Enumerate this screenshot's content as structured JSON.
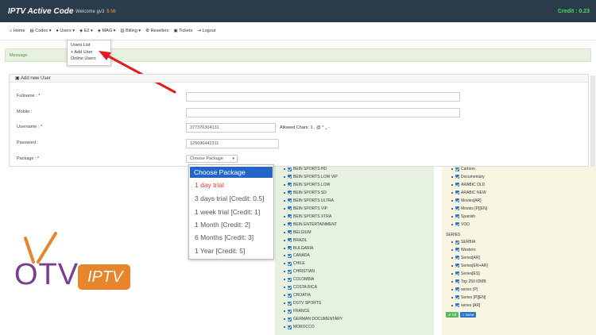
{
  "header": {
    "title": "IPTV Active Code",
    "welcome": "Welcome gv3",
    "user_number": "$ Mr",
    "credit": "Credit : 0.23"
  },
  "nav": [
    {
      "icon": "home-icon",
      "label": "Home"
    },
    {
      "icon": "codes-icon",
      "label": "Codes"
    },
    {
      "icon": "users-icon",
      "label": "Users"
    },
    {
      "icon": "e2-icon",
      "label": "E2"
    },
    {
      "icon": "mag-icon",
      "label": "MAG"
    },
    {
      "icon": "billing-icon",
      "label": "Billing"
    },
    {
      "icon": "resellers-icon",
      "label": "Resellers"
    },
    {
      "icon": "tickets-icon",
      "label": "Tickets"
    },
    {
      "icon": "logout-icon",
      "label": "Logout"
    }
  ],
  "users_menu": [
    "Users List",
    "+ Add User",
    "Online Users"
  ],
  "message": "Message",
  "panel": {
    "title": "Add new User",
    "labels": {
      "fullname": "Fullname : *",
      "mobile": "Mobile :",
      "username": "Username : *",
      "password": "Password :",
      "package": "Package : *"
    },
    "username_value": "377376304131",
    "password_value": "129696442311",
    "allowed_chars": "Allowed Chars: 1 , @ * _ -",
    "package_value": "Choose Package"
  },
  "packages": [
    "Choose Package",
    "1 day trial",
    "3 days trial [Credit: 0.5]",
    "1 week trial [Credit: 1]",
    "1 Month [Credit: 2]",
    "6 Months [Credit: 3]",
    "1 Year [Credit: 5]"
  ],
  "channels_left": [
    "BEIN SPORTS HD",
    "BEIN SPORTS LOW VIP",
    "BEIN SPORTS LOW",
    "BEIN SPORTS SD",
    "BEIN SPORTS ULTRA",
    "BEIN SPORTS VIP",
    "BEIN SPORTS XTRA",
    "BEIN ENTERTAINMENT",
    "BELGIUM",
    "BRAZIL",
    "BULGARIA",
    "CANADA",
    "CHILE",
    "CHRISTIAN",
    "COLOMBIA",
    "COSTA RICA",
    "CROATIA",
    "DSTV SPORTS",
    "FRANCE",
    "GERMAN DOCUMENTARY",
    "MOROCCO"
  ],
  "channels_right": [
    "Cartoon",
    "Documentary",
    "ARABIC OLD",
    "ARABIC NEW",
    "Movies[AR]",
    "Movies [P][EN]",
    "Spanish",
    "VOD"
  ],
  "series_header": "SERIES",
  "series": [
    "SERBIA",
    "Western",
    "Series[AR]",
    "Series[EN+AR]",
    "Series[ES]",
    "Top 250 IDMB",
    "series (P)",
    "Series [P][EN]",
    "series [AR]"
  ],
  "buttons": {
    "all": "All",
    "none": "None"
  },
  "brand": {
    "otv": "OTV",
    "iptv": "IPTV"
  },
  "colors": {
    "topbar": "#2a3b4c",
    "accent": "#2466c8",
    "arrow": "#e02020",
    "brand_purple": "#7b3d8f",
    "brand_orange": "#e8852c"
  }
}
